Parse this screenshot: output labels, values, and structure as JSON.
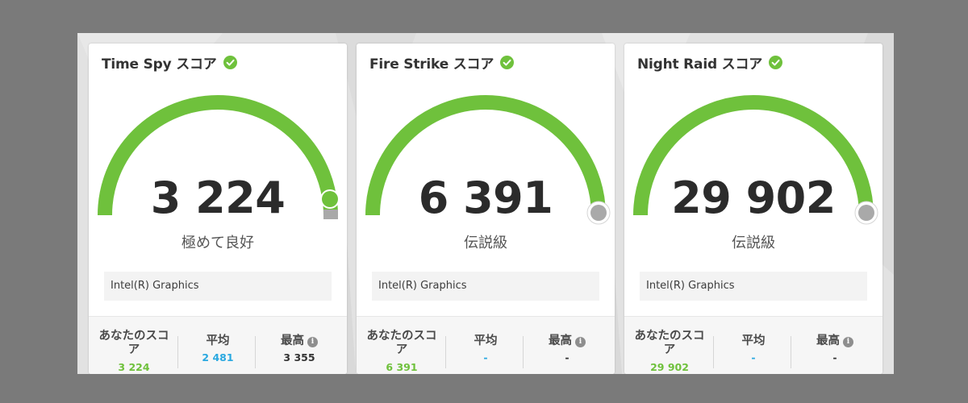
{
  "colors": {
    "accent": "#6fc13c",
    "avg_blue": "#29a8e0",
    "marker_gray": "#a9a9a9",
    "text_dark": "#2b2b2b"
  },
  "cards": [
    {
      "title": "Time Spy スコア",
      "verified_icon": "check-circle-icon",
      "score": "3 224",
      "rating": "極めて良好",
      "gauge_fraction": 1.0,
      "marker": "green",
      "gpu": "Intel(R) Graphics",
      "stats": {
        "your_label": "あなたのスコア",
        "your_value": "3 224",
        "avg_label": "平均",
        "avg_value": "2 481",
        "max_label": "最高",
        "max_value": "3 355",
        "info_icon": "info-icon"
      }
    },
    {
      "title": "Fire Strike スコア",
      "verified_icon": "check-circle-icon",
      "score": "6 391",
      "rating": "伝説級",
      "gauge_fraction": 1.0,
      "marker": "gray",
      "gpu": "Intel(R) Graphics",
      "stats": {
        "your_label": "あなたのスコア",
        "your_value": "6 391",
        "avg_label": "平均",
        "avg_value": "-",
        "max_label": "最高",
        "max_value": "-",
        "info_icon": "info-icon"
      }
    },
    {
      "title": "Night Raid スコア",
      "verified_icon": "check-circle-icon",
      "score": "29 902",
      "rating": "伝説級",
      "gauge_fraction": 1.0,
      "marker": "gray",
      "gpu": "Intel(R) Graphics",
      "stats": {
        "your_label": "あなたのスコア",
        "your_value": "29 902",
        "avg_label": "平均",
        "avg_value": "-",
        "max_label": "最高",
        "max_value": "-",
        "info_icon": "info-icon"
      }
    }
  ]
}
